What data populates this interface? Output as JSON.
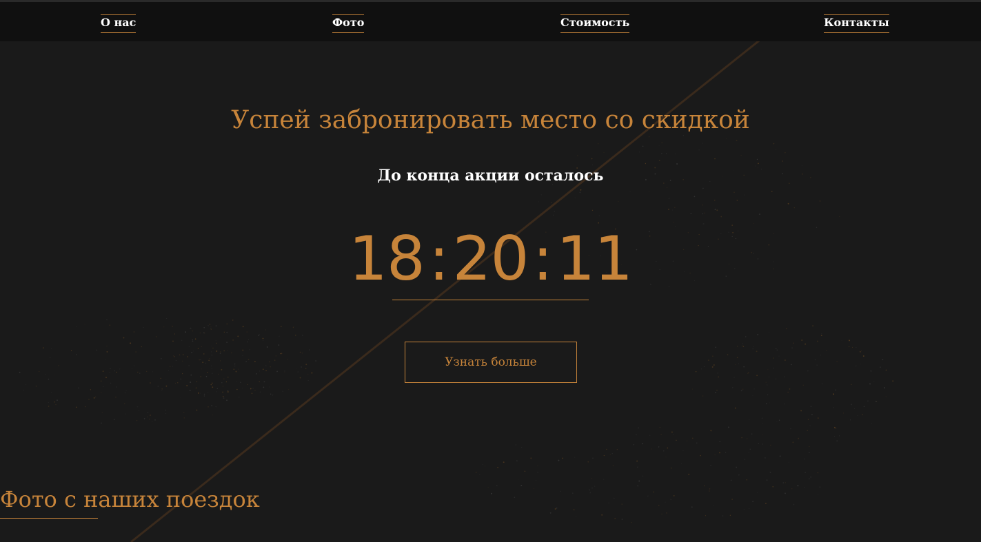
{
  "nav": {
    "items": [
      {
        "label": "О нас"
      },
      {
        "label": "Фото"
      },
      {
        "label": "Стоимость"
      },
      {
        "label": "Контакты"
      }
    ]
  },
  "hero": {
    "title": "Успей забронировать место со скидкой",
    "subtitle": "До конца акции осталось",
    "countdown": {
      "hours": "18",
      "minutes": "20",
      "seconds": "11",
      "separator": ":"
    },
    "button_label": "Узнать больше"
  },
  "photos_section": {
    "title": "Фото с наших поездок"
  },
  "colors": {
    "background": "#1a1a1a",
    "topbar": "#101010",
    "accent": "#c7843a",
    "text": "#ffffff"
  }
}
